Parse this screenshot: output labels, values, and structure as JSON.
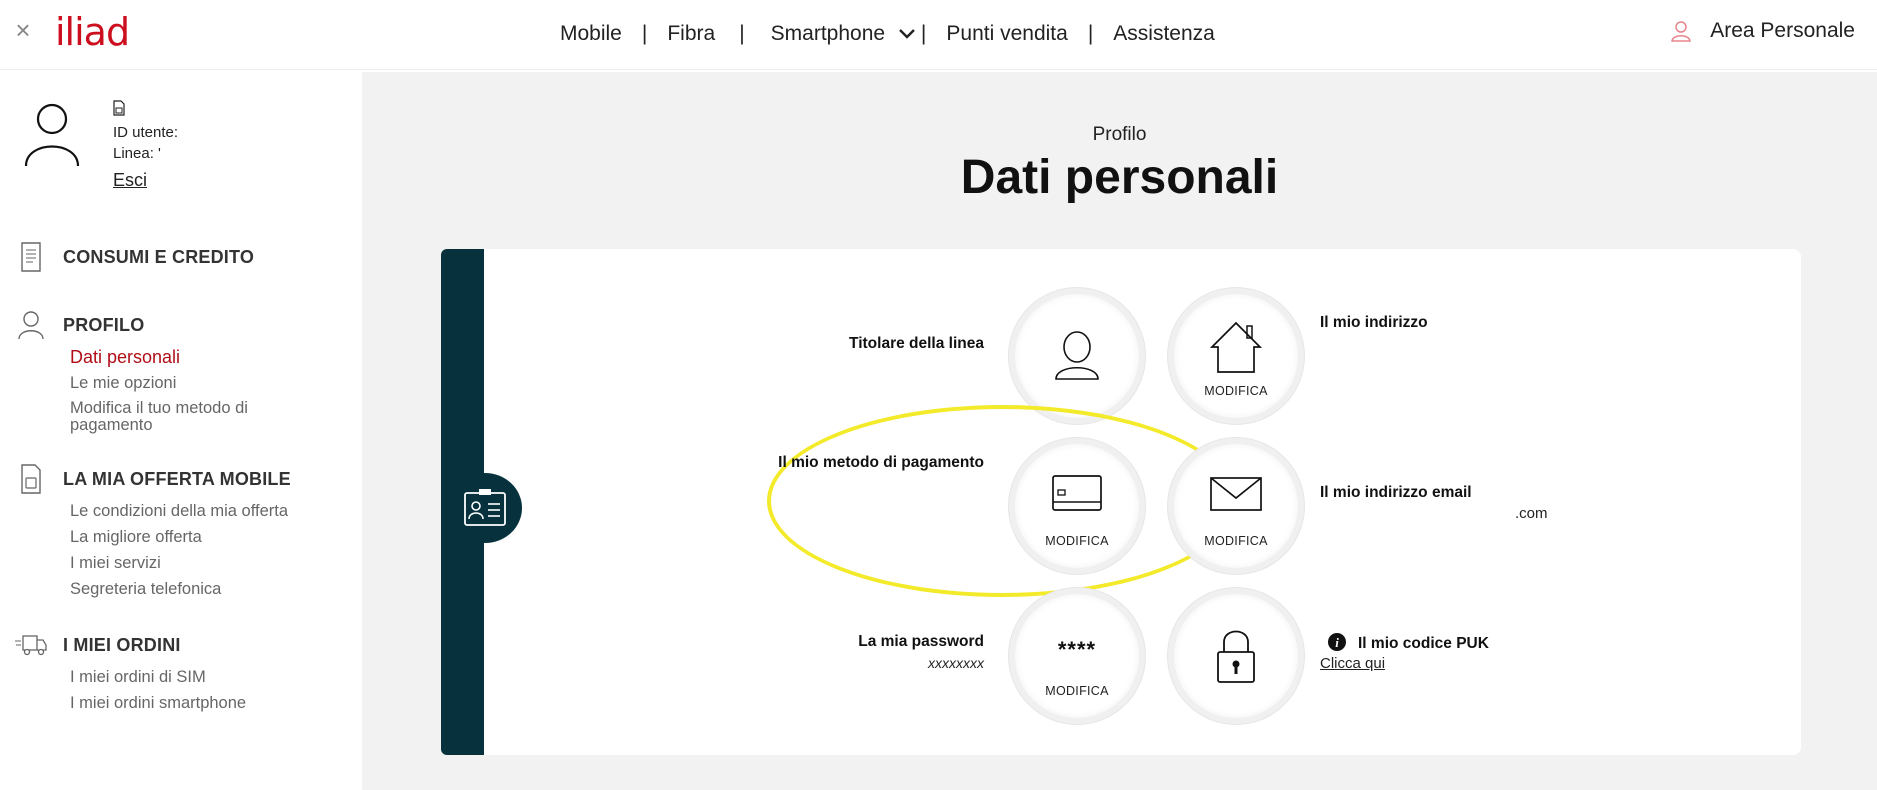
{
  "header": {
    "close_label": "×",
    "logo": "iliad",
    "nav": [
      {
        "label": "Mobile"
      },
      {
        "label": "Fibra"
      },
      {
        "label": "Smartphone"
      },
      {
        "label": "Punti vendita"
      },
      {
        "label": "Assistenza"
      }
    ],
    "separator": "|",
    "area_personale": "Area Personale",
    "accent_color": "#cc0f1e"
  },
  "sidebar": {
    "user": {
      "id_label": "ID utente:",
      "line_label": "Linea: '",
      "logout": "Esci"
    },
    "sections": [
      {
        "title": "CONSUMI E CREDITO",
        "icon": "receipt-icon",
        "items": []
      },
      {
        "title": "PROFILO",
        "icon": "person-icon",
        "items": [
          "Dati personali",
          "Le mie opzioni",
          "Modifica il tuo metodo di pagamento"
        ]
      },
      {
        "title": "LA MIA OFFERTA MOBILE",
        "icon": "sim-icon",
        "items": [
          "Le condizioni della mia offerta",
          "La migliore offerta",
          "I miei servizi",
          "Segreteria telefonica"
        ]
      },
      {
        "title": "I MIEI ORDINI",
        "icon": "truck-icon",
        "items": [
          "I miei ordini di SIM",
          "I miei ordini smartphone"
        ]
      }
    ],
    "active_item": "Dati personali"
  },
  "main": {
    "breadcrumb": "Profilo",
    "title": "Dati personali",
    "tiles": {
      "titolare": {
        "label": "Titolare della linea",
        "icon": "person-icon"
      },
      "indirizzo": {
        "label": "Il mio indirizzo",
        "action": "MODIFICA",
        "icon": "house-icon"
      },
      "pagamento": {
        "label": "Il mio metodo di pagamento",
        "action": "MODIFICA",
        "icon": "credit-card-icon"
      },
      "email": {
        "label": "Il mio indirizzo email",
        "value": ".com",
        "action": "MODIFICA",
        "icon": "envelope-icon"
      },
      "password": {
        "label": "La mia password",
        "value": "xxxxxxxx",
        "masked": "****",
        "action": "MODIFICA"
      },
      "puk": {
        "label": "Il mio codice PUK",
        "link": "Clicca qui",
        "icon": "padlock-icon",
        "info_icon": "info-icon"
      }
    },
    "highlight_color": "#f3ea2a"
  }
}
